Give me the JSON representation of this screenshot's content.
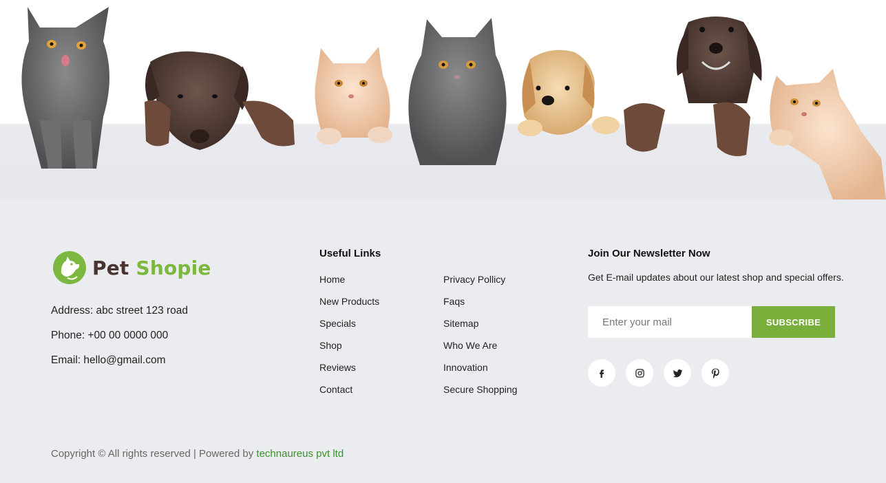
{
  "brand": {
    "name_part1": "Pet",
    "name_part2": "Shopie",
    "accent_color": "#7cb740",
    "dark_color": "#4a3432"
  },
  "contact": {
    "address": "Address: abc street 123 road",
    "phone": "Phone: +00 00 0000 000",
    "email": "Email: hello@gmail.com"
  },
  "useful_links": {
    "title": "Useful Links",
    "column1": [
      "Home",
      "New Products",
      "Specials",
      "Shop",
      "Reviews",
      "Contact"
    ],
    "column2": [
      "Privacy Pollicy",
      "Faqs",
      "Sitemap",
      "Who We Are",
      "Innovation",
      "Secure Shopping"
    ]
  },
  "newsletter": {
    "title": "Join Our Newsletter Now",
    "description": "Get E-mail updates about our latest shop and special offers.",
    "input_placeholder": "Enter your mail",
    "button_label": "SUBSCRIBE",
    "button_color": "#7aae3b"
  },
  "socials": [
    {
      "icon": "facebook-icon"
    },
    {
      "icon": "instagram-icon"
    },
    {
      "icon": "twitter-icon"
    },
    {
      "icon": "pinterest-icon"
    }
  ],
  "footer": {
    "copyright_text": "Copyright © All rights reserved | Powered by ",
    "powered_by_link": "technaureus pvt ltd"
  }
}
